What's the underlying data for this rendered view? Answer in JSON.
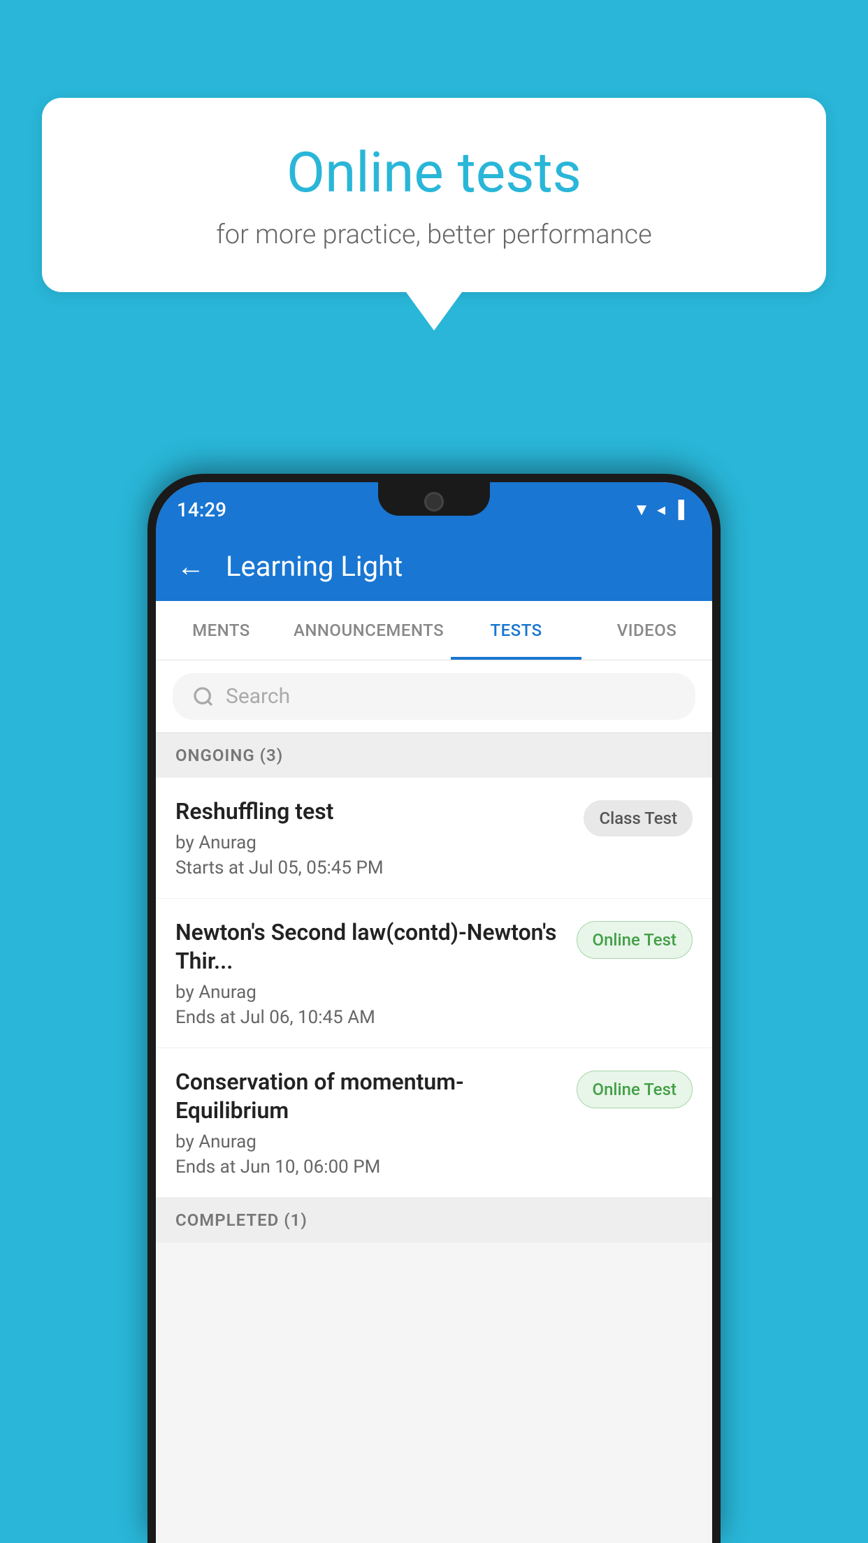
{
  "background_color": "#29b6d8",
  "speech_bubble": {
    "title": "Online tests",
    "subtitle": "for more practice, better performance"
  },
  "phone": {
    "status_bar": {
      "time": "14:29",
      "icons": [
        "wifi",
        "signal",
        "battery"
      ]
    },
    "header": {
      "title": "Learning Light",
      "back_label": "←"
    },
    "tabs": [
      {
        "label": "MENTS",
        "active": false
      },
      {
        "label": "ANNOUNCEMENTS",
        "active": false
      },
      {
        "label": "TESTS",
        "active": true
      },
      {
        "label": "VIDEOS",
        "active": false
      }
    ],
    "search": {
      "placeholder": "Search"
    },
    "sections": [
      {
        "header": "ONGOING (3)",
        "items": [
          {
            "name": "Reshuffling test",
            "author": "by Anurag",
            "time": "Starts at  Jul 05, 05:45 PM",
            "badge": "Class Test",
            "badge_type": "class"
          },
          {
            "name": "Newton's Second law(contd)-Newton's Thir...",
            "author": "by Anurag",
            "time": "Ends at  Jul 06, 10:45 AM",
            "badge": "Online Test",
            "badge_type": "online"
          },
          {
            "name": "Conservation of momentum-Equilibrium",
            "author": "by Anurag",
            "time": "Ends at  Jun 10, 06:00 PM",
            "badge": "Online Test",
            "badge_type": "online"
          }
        ]
      },
      {
        "header": "COMPLETED (1)",
        "items": []
      }
    ]
  }
}
